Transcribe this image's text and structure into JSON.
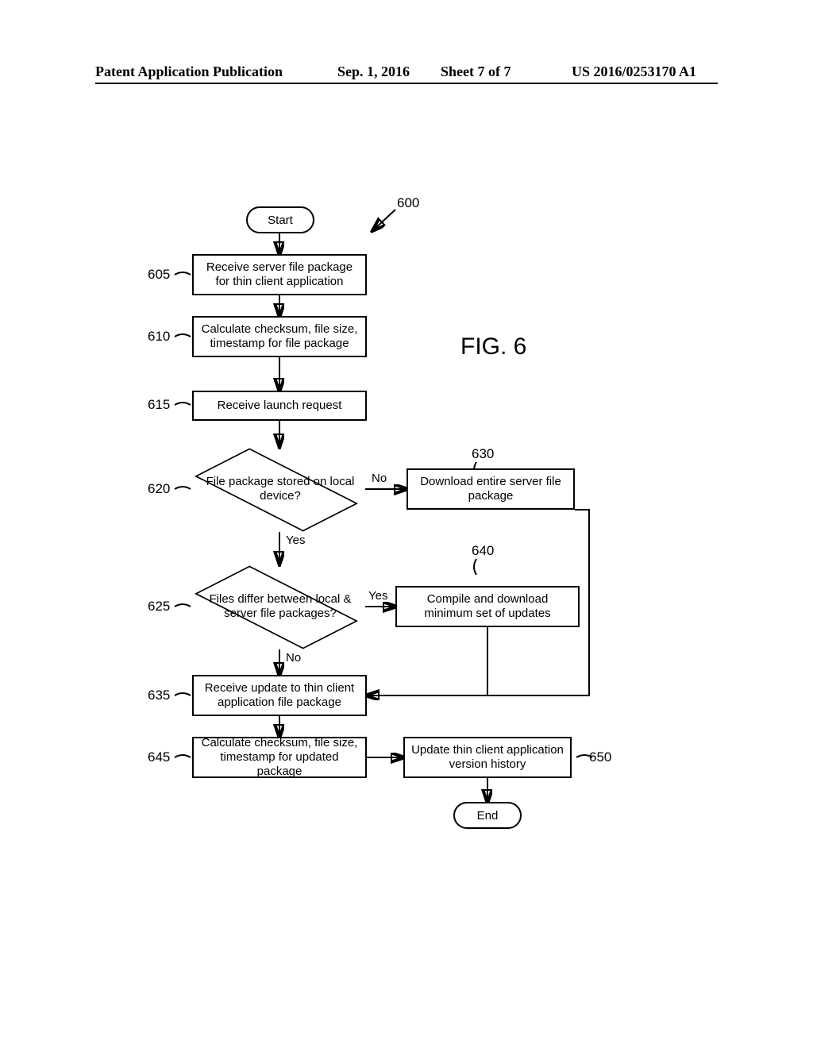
{
  "header": {
    "left": "Patent Application Publication",
    "center": "Sep. 1, 2016",
    "sheet": "Sheet 7 of 7",
    "right": "US 2016/0253170 A1"
  },
  "figure": {
    "title": "FIG. 6",
    "ref_main": "600",
    "terminal_start": "Start",
    "terminal_end": "End",
    "steps": {
      "605": {
        "ref": "605",
        "text": "Receive server file package for thin client application"
      },
      "610": {
        "ref": "610",
        "text": "Calculate checksum, file size, timestamp for file package"
      },
      "615": {
        "ref": "615",
        "text": "Receive launch request"
      },
      "620": {
        "ref": "620",
        "text": "File package stored on local device?"
      },
      "625": {
        "ref": "625",
        "text": "Files differ between local & server file packages?"
      },
      "630": {
        "ref": "630",
        "text": "Download entire server file package"
      },
      "635": {
        "ref": "635",
        "text": "Receive update to thin client application file package"
      },
      "640": {
        "ref": "640",
        "text": "Compile and download minimum set of updates"
      },
      "645": {
        "ref": "645",
        "text": "Calculate checksum, file size, timestamp for updated package"
      },
      "650": {
        "ref": "650",
        "text": "Update thin client application version history"
      }
    },
    "branch_labels": {
      "no": "No",
      "yes": "Yes"
    }
  }
}
